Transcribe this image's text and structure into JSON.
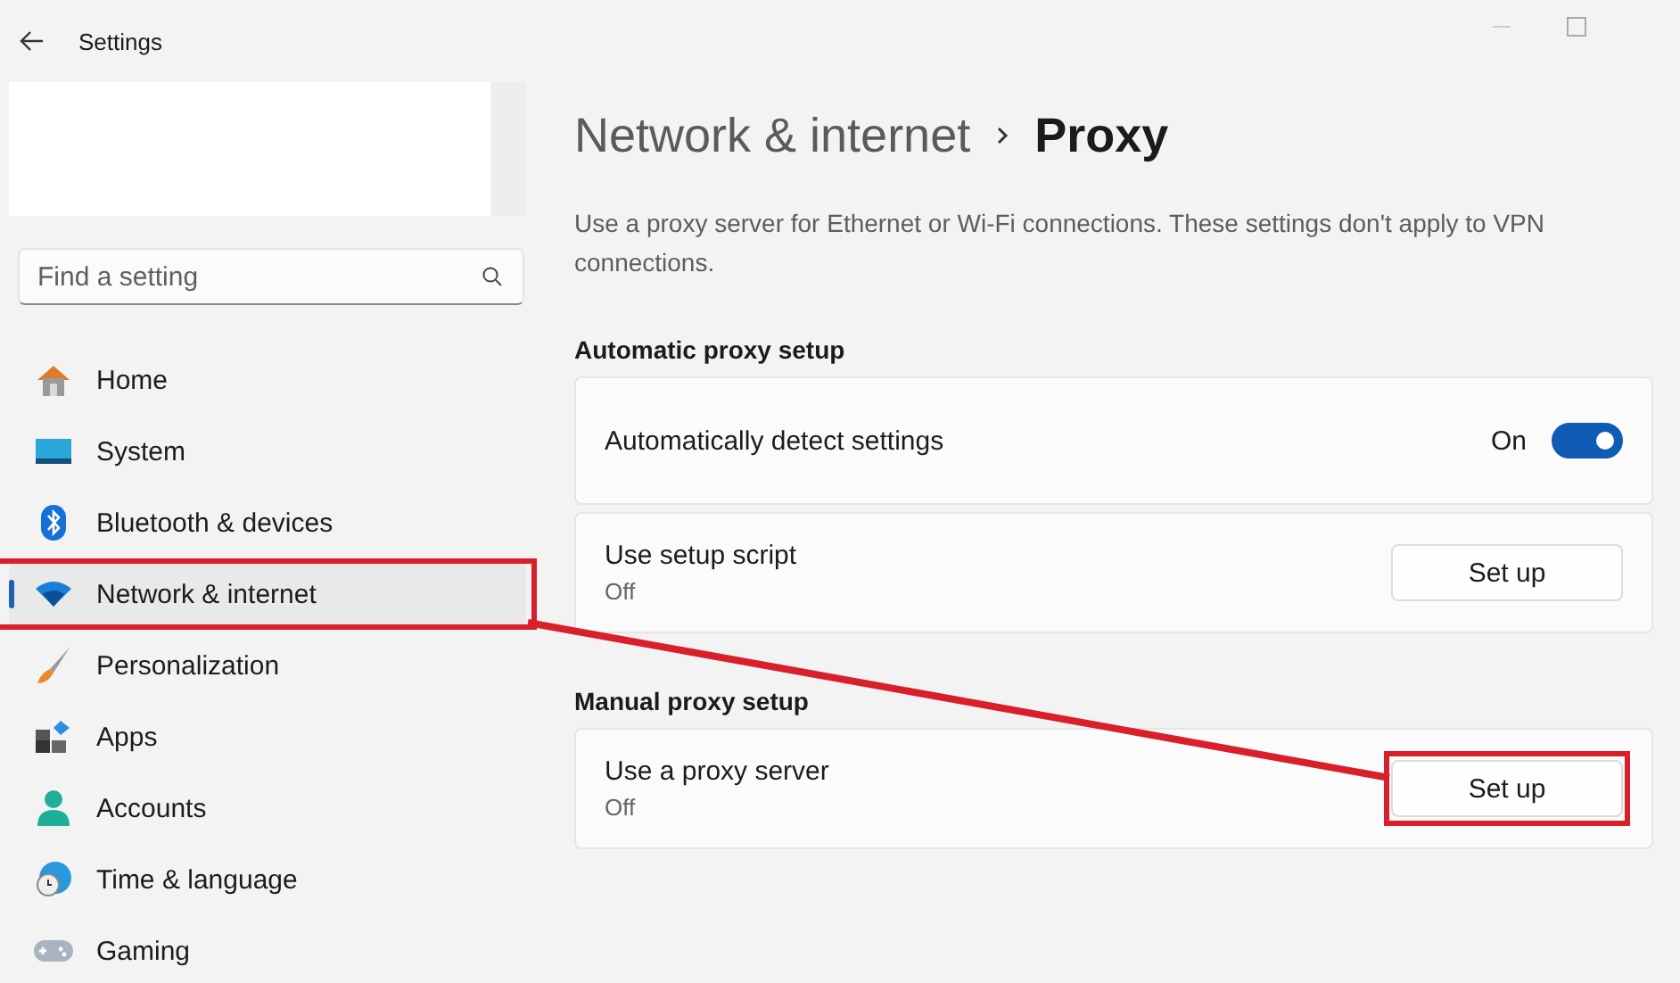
{
  "window": {
    "title": "Settings"
  },
  "search": {
    "placeholder": "Find a setting"
  },
  "nav": [
    {
      "label": "Home",
      "selected": false,
      "highlighted": false
    },
    {
      "label": "System",
      "selected": false,
      "highlighted": false
    },
    {
      "label": "Bluetooth & devices",
      "selected": false,
      "highlighted": false
    },
    {
      "label": "Network & internet",
      "selected": true,
      "highlighted": true
    },
    {
      "label": "Personalization",
      "selected": false,
      "highlighted": false
    },
    {
      "label": "Apps",
      "selected": false,
      "highlighted": false
    },
    {
      "label": "Accounts",
      "selected": false,
      "highlighted": false
    },
    {
      "label": "Time & language",
      "selected": false,
      "highlighted": false
    },
    {
      "label": "Gaming",
      "selected": false,
      "highlighted": false
    }
  ],
  "breadcrumb": [
    "Network & internet",
    "Proxy"
  ],
  "description": "Use a proxy server for Ethernet or Wi-Fi connections. These settings don't apply to VPN connections.",
  "sections": [
    {
      "title": "Automatic proxy setup",
      "rows": [
        {
          "kind": "toggle",
          "label": "Automatically detect settings",
          "state_text": "On",
          "on": true
        },
        {
          "kind": "button",
          "label": "Use setup script",
          "subtitle": "Off",
          "button": "Set up",
          "highlighted": false
        }
      ]
    },
    {
      "title": "Manual proxy setup",
      "rows": [
        {
          "kind": "button",
          "label": "Use a proxy server",
          "subtitle": "Off",
          "button": "Set up",
          "highlighted": true
        }
      ]
    }
  ]
}
